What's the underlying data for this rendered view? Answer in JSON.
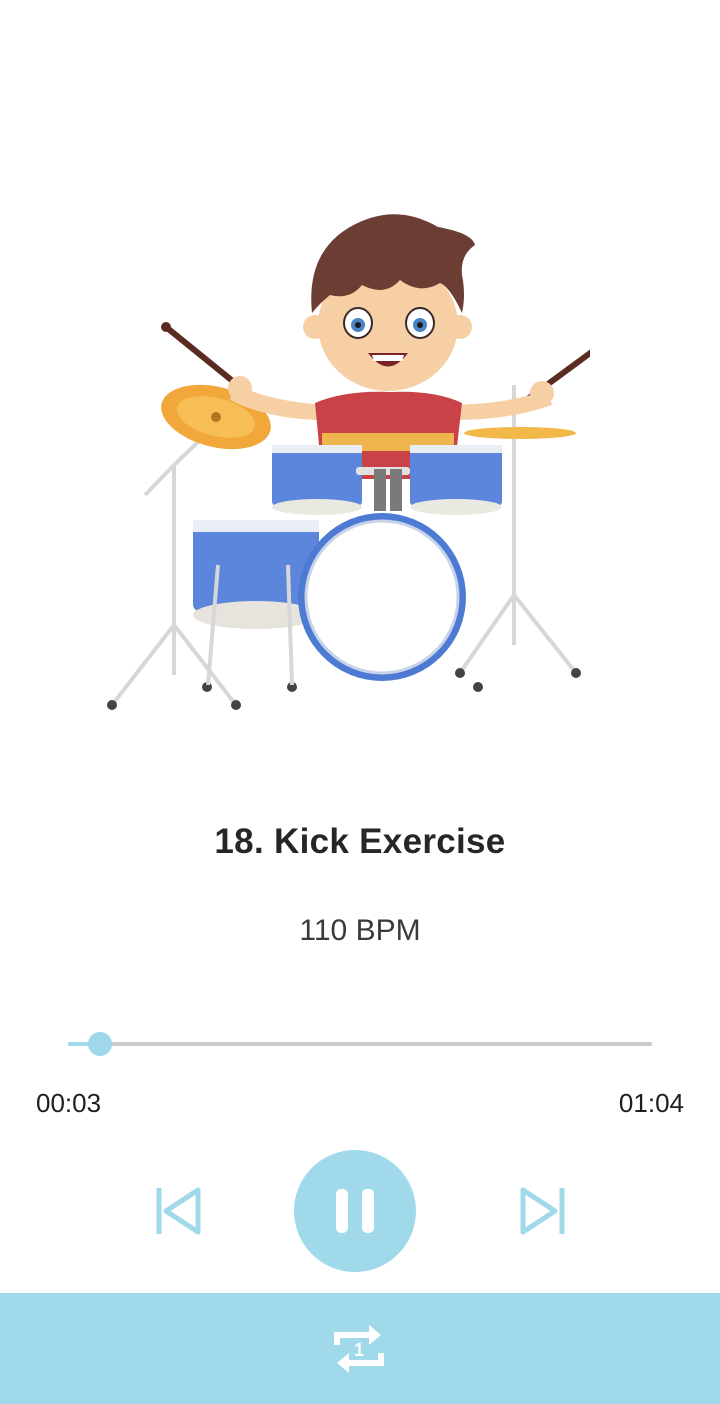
{
  "track": {
    "title": "18. Kick Exercise",
    "tempo": "110 BPM"
  },
  "playback": {
    "elapsed": "00:03",
    "duration": "01:04",
    "progress": 0.055,
    "state": "playing"
  },
  "controls": {
    "previous_icon": "skip-previous-icon",
    "play_pause_icon": "pause-icon",
    "next_icon": "skip-next-icon",
    "repeat_icon": "repeat-one-icon",
    "repeat_badge": "1"
  },
  "colors": {
    "accent": "#a0d9ea",
    "seek_track": "#c9c9c9",
    "title_text": "#262626"
  }
}
